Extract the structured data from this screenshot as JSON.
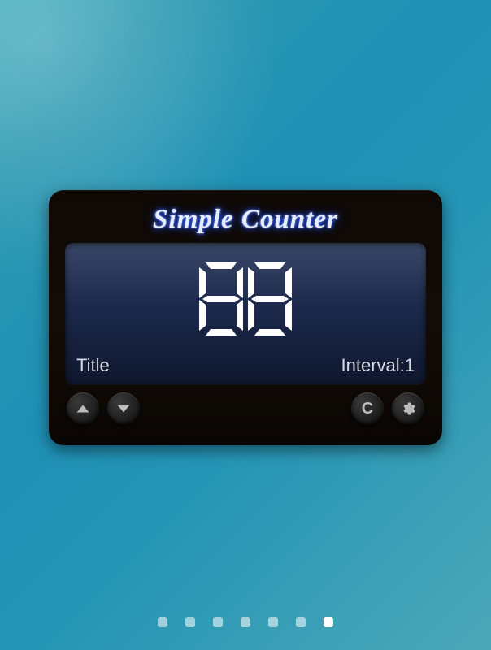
{
  "app": {
    "title": "Simple Counter"
  },
  "counter": {
    "value": "88",
    "title_label": "Title",
    "interval_label": "Interval:1"
  },
  "buttons": {
    "up": "▲",
    "down": "▼",
    "clear": "C",
    "settings": "⚙"
  },
  "pagination": {
    "count": 7,
    "active_index": 6
  },
  "colors": {
    "bg_gradient_start": "#3aa8b8",
    "bg_gradient_end": "#4ca8b8",
    "widget_bg": "#0e0905",
    "display_bg": "#1b2849",
    "title_glow": "#2a5bff"
  }
}
